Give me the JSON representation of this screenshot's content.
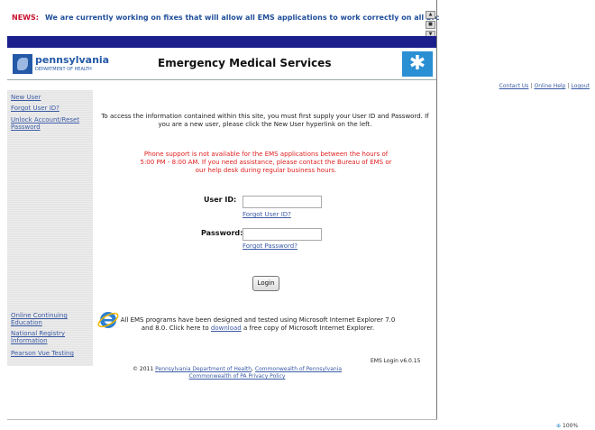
{
  "news": {
    "label": "NEWS:",
    "text": "We are currently working on fixes that will allow all EMS applications to work correctly on all brc",
    "controls": [
      "up-icon",
      "pause-icon",
      "down-icon"
    ]
  },
  "header": {
    "logo_name": "pennsylvania",
    "logo_sub": "DEPARTMENT OF HEALTH",
    "title": "Emergency Medical Services",
    "star_icon": "star-of-life-icon"
  },
  "top_links": {
    "contact": "Contact Us",
    "help": "Online Help",
    "logout": "Logout",
    "separator": "|"
  },
  "sidebar": {
    "top_items": [
      {
        "label": "New User"
      },
      {
        "label": "Forgot User ID?"
      },
      {
        "label": "Unlock Account/Reset Password"
      }
    ],
    "bottom_items": [
      {
        "label": "Online Continuing Education"
      },
      {
        "label": "National Registry Information"
      },
      {
        "label": "Pearson Vue Testing"
      }
    ]
  },
  "main": {
    "intro": "To access the information contained within this site, you must first supply your User ID and Password. If you are a new user, please click the New User hyperlink on the left.",
    "phone_notice": "Phone support is not available for the EMS applications between the hours of 5:00 PM - 8:00 AM. If you need assistance, please contact the Bureau of EMS or our help desk during regular business hours.",
    "user_label": "User ID:",
    "user_value": "",
    "forgot_user": "Forgot User ID?",
    "password_label": "Password:",
    "password_value": "",
    "forgot_password": "Forgot Password?",
    "login_button": "Login",
    "ie_prefix": "All EMS programs have been designed and tested using Microsoft Internet Explorer 7.0 and 8.0. Click here to",
    "ie_link": "download",
    "ie_suffix": "a free copy of Microsoft Internet Explorer.",
    "version": "EMS Login v6.0.15"
  },
  "footer": {
    "copyright": "© 2011",
    "dept_link": "Pennsylvania Department of Health",
    "comma": ",",
    "commonwealth_link": "Commonwealth of Pennsylvania",
    "privacy_link": "Commonwealth of PA Privacy Policy"
  },
  "status": {
    "zoom": "100%",
    "zoom_icon": "zoom-icon"
  },
  "colors": {
    "accent": "#1a1f8c",
    "link": "#3b5ba5",
    "news_label": "#c8102e",
    "phone_notice": "#e02020"
  }
}
